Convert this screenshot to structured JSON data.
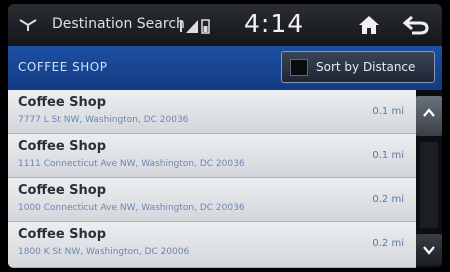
{
  "status_bar": {
    "title": "Destination Search",
    "time": "4:14",
    "icons": [
      "navigation-icon",
      "bluetooth-icon",
      "signal-icon",
      "battery-icon",
      "home-icon",
      "back-icon"
    ]
  },
  "header": {
    "title": "COFFEE SHOP",
    "sort_label": "Sort by Distance"
  },
  "results": [
    {
      "name": "Coffee Shop",
      "address": "7777 L St NW, Washington, DC 20036",
      "distance": "0.1 mi"
    },
    {
      "name": "Coffee Shop",
      "address": "1111 Connecticut Ave NW, Washington, DC 20036",
      "distance": "0.1 mi"
    },
    {
      "name": "Coffee Shop",
      "address": "1000 Connecticut Ave NW, Washington, DC 20036",
      "distance": "0.2 mi"
    },
    {
      "name": "Coffee Shop",
      "address": "1800 K St NW, Washington, DC 20006",
      "distance": "0.2 mi"
    }
  ],
  "colors": {
    "header_blue": "#1d4fa3",
    "list_bg": "#e3e6e9",
    "address_blue": "#6d86b5"
  }
}
